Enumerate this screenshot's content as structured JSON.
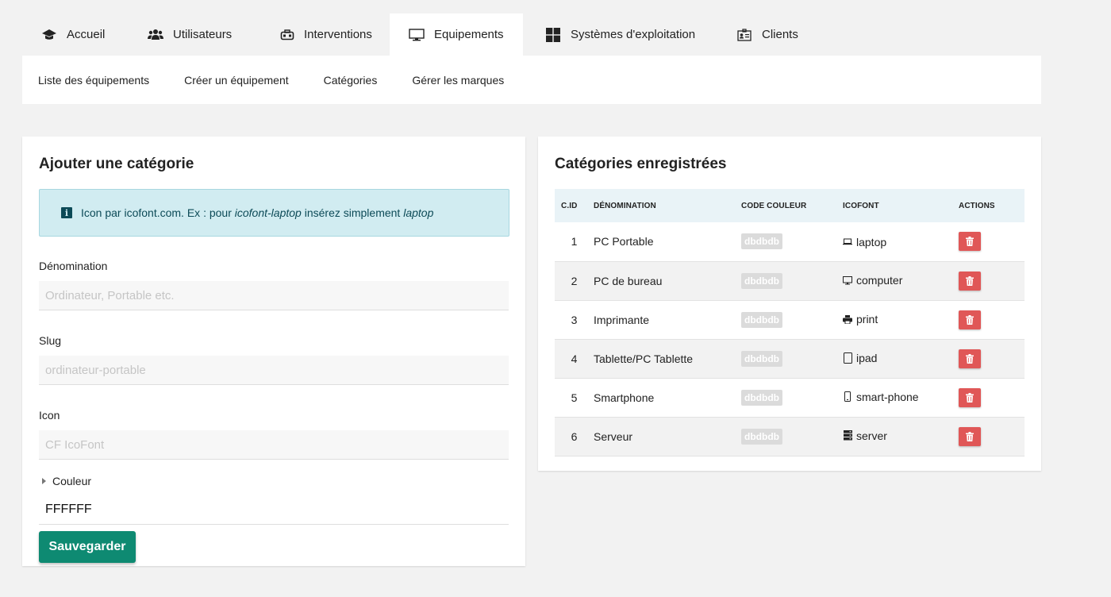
{
  "tabs": [
    {
      "label": "Accueil",
      "icon": "home-icon"
    },
    {
      "label": "Utilisateurs",
      "icon": "users-icon"
    },
    {
      "label": "Interventions",
      "icon": "toolbox-icon"
    },
    {
      "label": "Equipements",
      "icon": "monitor-icon",
      "active": true
    },
    {
      "label": "Systèmes d'exploitation",
      "icon": "windows-icon"
    },
    {
      "label": "Clients",
      "icon": "id-card-icon"
    }
  ],
  "subnav": [
    "Liste des équipements",
    "Créer un équipement",
    "Catégories",
    "Gérer les marques"
  ],
  "form": {
    "title": "Ajouter une catégorie",
    "info_prefix": "Icon par icofont.com. Ex : pour ",
    "info_em1": "icofont-laptop",
    "info_mid": " insérez simplement ",
    "info_em2": "laptop",
    "denomination_label": "Dénomination",
    "denomination_placeholder": "Ordinateur, Portable etc.",
    "slug_label": "Slug",
    "slug_placeholder": "ordinateur-portable",
    "icon_label": "Icon",
    "icon_placeholder": "CF IcoFont",
    "couleur_label": "Couleur",
    "couleur_value": "FFFFFF",
    "save_label": "Sauvegarder"
  },
  "table": {
    "title": "Catégories enregistrées",
    "headers": [
      "C.ID",
      "Dénomination",
      "Code couleur",
      "Icofont",
      "Actions"
    ],
    "rows": [
      {
        "id": "1",
        "name": "PC Portable",
        "color": "dbdbdb",
        "icon": "laptop",
        "glyph": "laptop-icon"
      },
      {
        "id": "2",
        "name": "PC de bureau",
        "color": "dbdbdb",
        "icon": "computer",
        "glyph": "computer-icon"
      },
      {
        "id": "3",
        "name": "Imprimante",
        "color": "dbdbdb",
        "icon": "print",
        "glyph": "printer-icon"
      },
      {
        "id": "4",
        "name": "Tablette/PC Tablette",
        "color": "dbdbdb",
        "icon": "ipad",
        "glyph": "tablet-icon"
      },
      {
        "id": "5",
        "name": "Smartphone",
        "color": "dbdbdb",
        "icon": "smart-phone",
        "glyph": "smartphone-icon"
      },
      {
        "id": "6",
        "name": "Serveur",
        "color": "dbdbdb",
        "icon": "server",
        "glyph": "server-icon"
      }
    ]
  },
  "colors": {
    "save_button": "#0e8a72",
    "delete_button": "#e05757",
    "info_bg": "#d1ecf1",
    "table_header_bg": "#e9f3f7",
    "badge_bg": "#dbdbdb"
  }
}
